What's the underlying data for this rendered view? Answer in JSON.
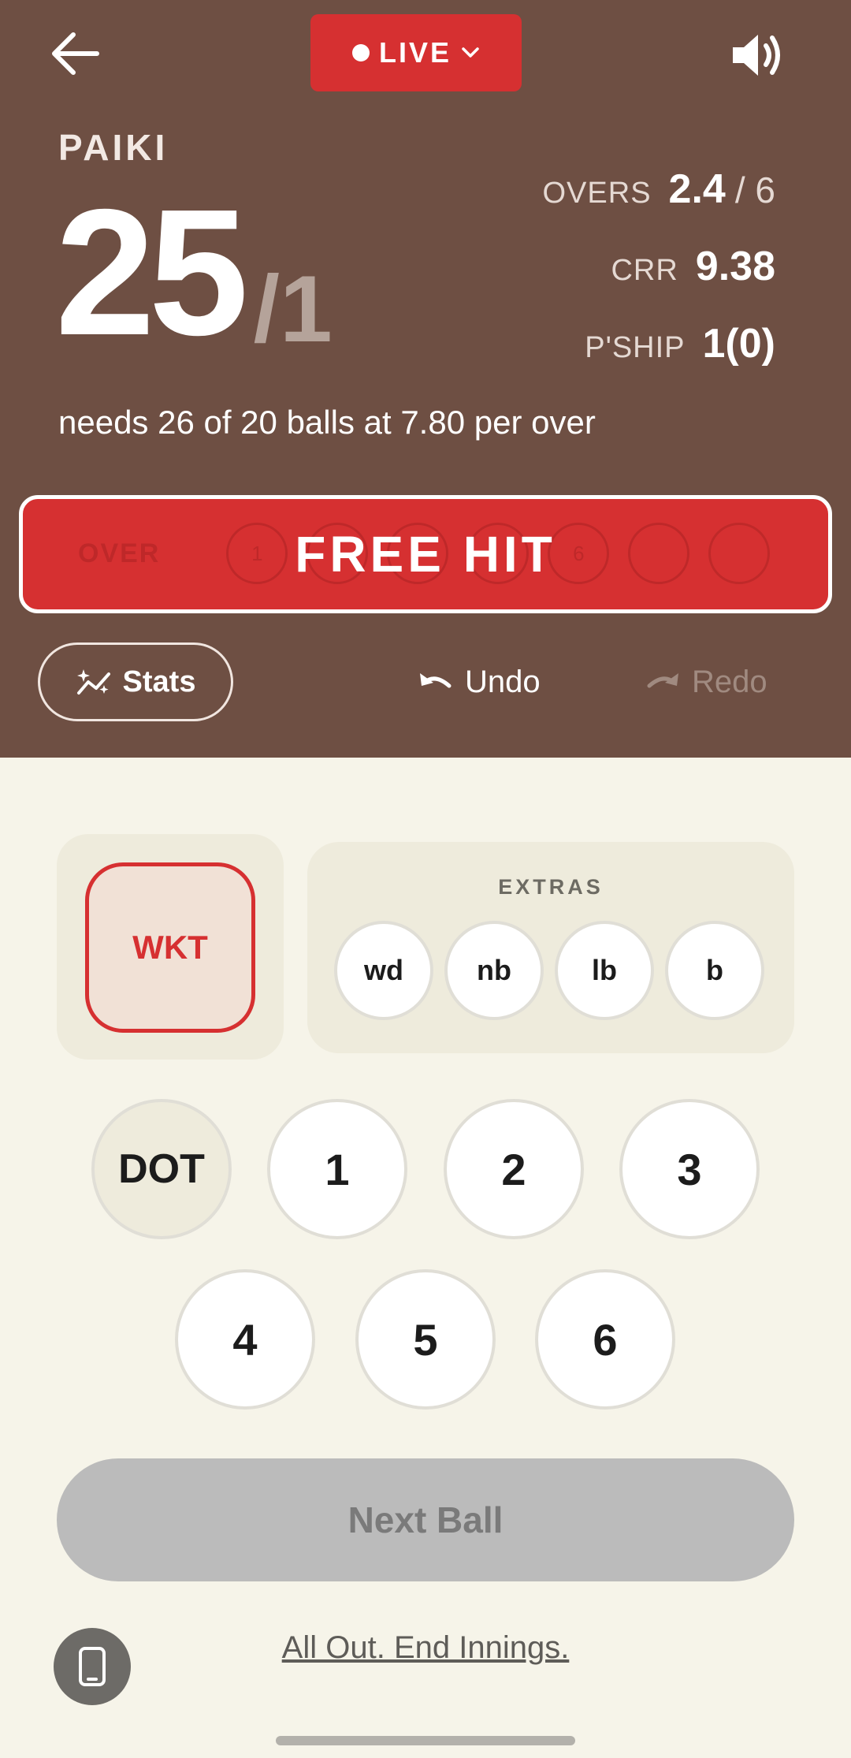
{
  "header": {
    "back_icon": "arrow-left-icon",
    "live_label": "LIVE",
    "live_chevron_icon": "chevron-down-icon",
    "sound_icon": "speaker-icon"
  },
  "score": {
    "team": "PAIKI",
    "runs": "25",
    "wickets": "/1",
    "overs_label": "OVERS",
    "overs_value": "2.4",
    "overs_max": "/ 6",
    "crr_label": "CRR",
    "crr_value": "9.38",
    "pship_label": "P'SHIP",
    "pship_value": "1(0)",
    "needs_text": "needs 26 of 20 balls at 7.80 per over"
  },
  "banner": {
    "label": "FREE HIT",
    "ghost_over_label": "OVER",
    "ghost_balls": [
      "1",
      "",
      "",
      "",
      "6",
      "",
      ""
    ]
  },
  "actions": {
    "stats_label": "Stats",
    "stats_icon": "sparkle-chart-icon",
    "undo_label": "Undo",
    "undo_icon": "undo-icon",
    "redo_label": "Redo",
    "redo_icon": "redo-icon"
  },
  "wicket": {
    "label": "WKT"
  },
  "extras": {
    "title": "EXTRAS",
    "buttons": [
      "wd",
      "nb",
      "lb",
      "b"
    ]
  },
  "runs": {
    "dot": "DOT",
    "one": "1",
    "two": "2",
    "three": "3",
    "four": "4",
    "five": "5",
    "six": "6"
  },
  "footer": {
    "next_ball": "Next Ball",
    "device_icon": "phone-icon",
    "end_innings": "All Out. End Innings."
  },
  "colors": {
    "header_bg": "#6e4f43",
    "accent_red": "#d63031",
    "page_bg": "#f6f4e9",
    "card_bg": "#eeebdc",
    "disabled_button": "#bbbbbb"
  }
}
